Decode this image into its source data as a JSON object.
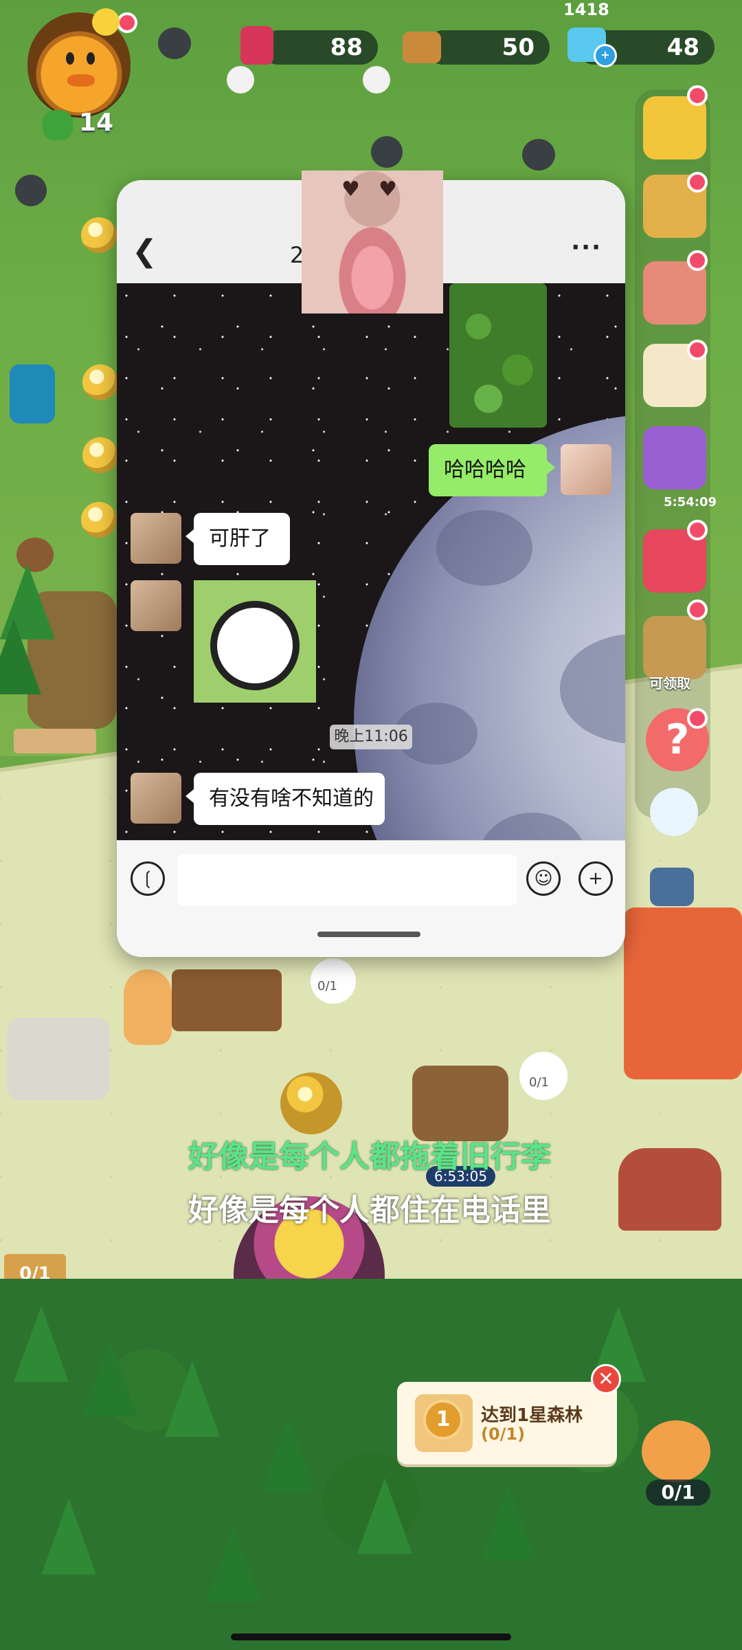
{
  "hud": {
    "clover_count": "14",
    "resource_1": "88",
    "resource_2": "50",
    "resource_3": "48",
    "top_partial": "1418"
  },
  "chat": {
    "title_fragment": "2",
    "back_icon": "chevron-left-icon",
    "more_label": "···",
    "messages": [
      {
        "side": "out",
        "text": "哈哈哈哈"
      },
      {
        "side": "in",
        "text": "可肝了"
      },
      {
        "side": "in",
        "text": "有没有啥不知道的"
      }
    ],
    "time_label": "晚上11:06",
    "input_placeholder": ""
  },
  "side_menu": {
    "timer": "5:54:09",
    "claim_label": "可领取"
  },
  "lyrics": {
    "line_1": "好像是每个人都拖着旧行李",
    "line_2": "好像是每个人都住在电话里"
  },
  "game": {
    "event_timer": "6:53:05",
    "quest_title": "达到1星森林",
    "quest_progress": "(0/1)",
    "quest_medal": "1",
    "cat_progress": "0/1",
    "sign_progress": "0/1",
    "bubble_progress_1": "0/1",
    "bubble_progress_2": "0/1"
  },
  "colors": {
    "accent_green": "#95ec69",
    "lyric_green": "#5be38a",
    "badge_red": "#f24b6a"
  }
}
